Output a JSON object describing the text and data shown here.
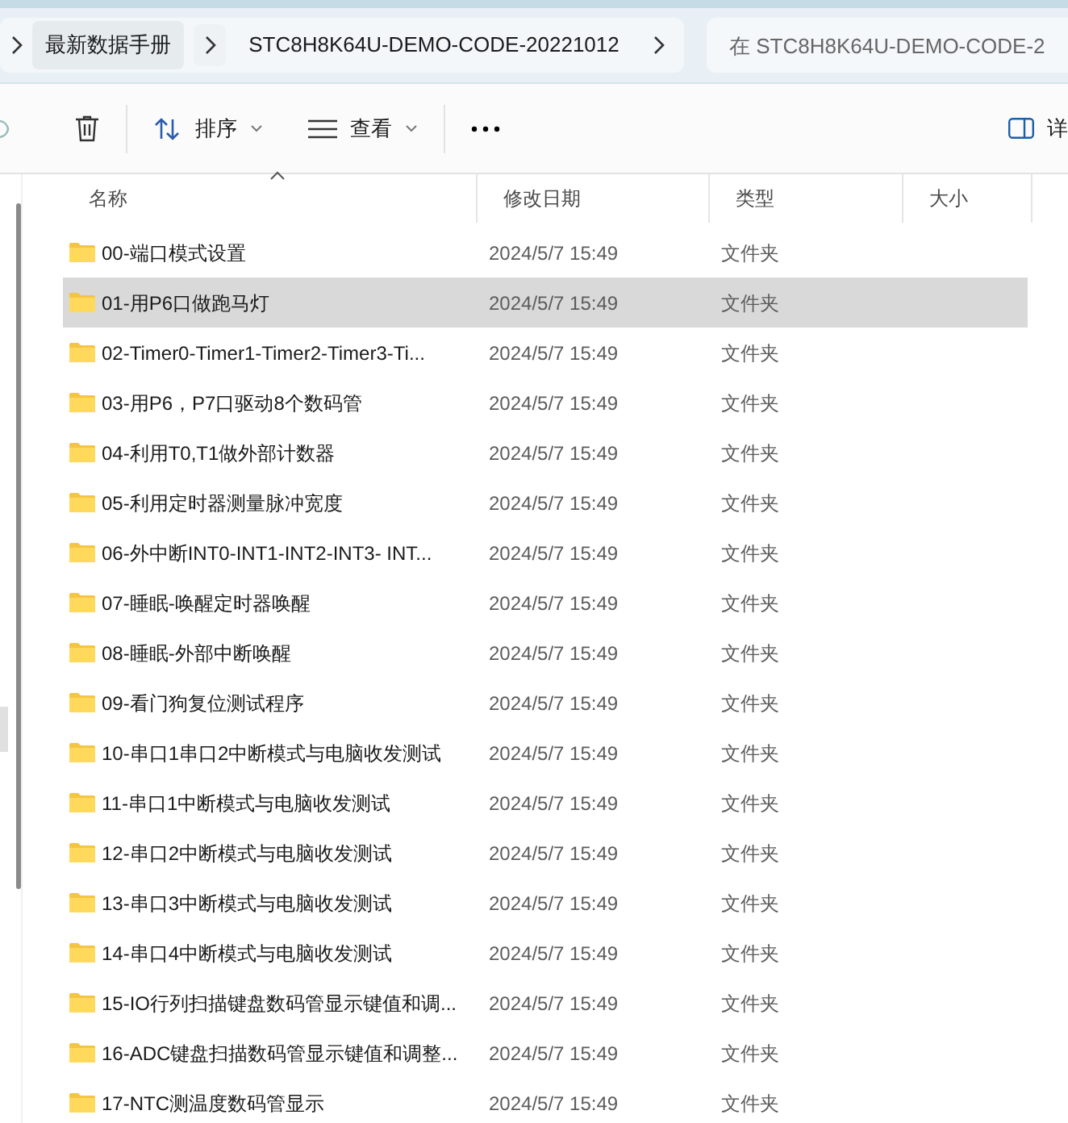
{
  "address_bar": {
    "breadcrumbs": [
      {
        "label": "最新数据手册"
      },
      {
        "label": "STC8H8K64U-DEMO-CODE-20221012"
      }
    ],
    "search": {
      "placeholder": "在 STC8H8K64U-DEMO-CODE-2"
    }
  },
  "toolbar": {
    "sort": {
      "label": "排序"
    },
    "view": {
      "label": "查看"
    },
    "details": {
      "label": "详"
    }
  },
  "table": {
    "columns": [
      {
        "label": "名称",
        "sorted": true
      },
      {
        "label": "修改日期",
        "sorted": false
      },
      {
        "label": "类型",
        "sorted": false
      },
      {
        "label": "大小",
        "sorted": false
      }
    ],
    "rows": [
      {
        "name": "00-端口模式设置",
        "modified": "2024/5/7 15:49",
        "type": "文件夹",
        "selected": false
      },
      {
        "name": "01-用P6口做跑马灯",
        "modified": "2024/5/7 15:49",
        "type": "文件夹",
        "selected": true
      },
      {
        "name": "02-Timer0-Timer1-Timer2-Timer3-Ti...",
        "modified": "2024/5/7 15:49",
        "type": "文件夹",
        "selected": false
      },
      {
        "name": "03-用P6，P7口驱动8个数码管",
        "modified": "2024/5/7 15:49",
        "type": "文件夹",
        "selected": false
      },
      {
        "name": "04-利用T0,T1做外部计数器",
        "modified": "2024/5/7 15:49",
        "type": "文件夹",
        "selected": false
      },
      {
        "name": "05-利用定时器测量脉冲宽度",
        "modified": "2024/5/7 15:49",
        "type": "文件夹",
        "selected": false
      },
      {
        "name": "06-外中断INT0-INT1-INT2-INT3- INT...",
        "modified": "2024/5/7 15:49",
        "type": "文件夹",
        "selected": false
      },
      {
        "name": "07-睡眠-唤醒定时器唤醒",
        "modified": "2024/5/7 15:49",
        "type": "文件夹",
        "selected": false
      },
      {
        "name": "08-睡眠-外部中断唤醒",
        "modified": "2024/5/7 15:49",
        "type": "文件夹",
        "selected": false
      },
      {
        "name": "09-看门狗复位测试程序",
        "modified": "2024/5/7 15:49",
        "type": "文件夹",
        "selected": false
      },
      {
        "name": "10-串口1串口2中断模式与电脑收发测试",
        "modified": "2024/5/7 15:49",
        "type": "文件夹",
        "selected": false
      },
      {
        "name": "11-串口1中断模式与电脑收发测试",
        "modified": "2024/5/7 15:49",
        "type": "文件夹",
        "selected": false
      },
      {
        "name": "12-串口2中断模式与电脑收发测试",
        "modified": "2024/5/7 15:49",
        "type": "文件夹",
        "selected": false
      },
      {
        "name": "13-串口3中断模式与电脑收发测试",
        "modified": "2024/5/7 15:49",
        "type": "文件夹",
        "selected": false
      },
      {
        "name": "14-串口4中断模式与电脑收发测试",
        "modified": "2024/5/7 15:49",
        "type": "文件夹",
        "selected": false
      },
      {
        "name": "15-IO行列扫描键盘数码管显示键值和调...",
        "modified": "2024/5/7 15:49",
        "type": "文件夹",
        "selected": false
      },
      {
        "name": "16-ADC键盘扫描数码管显示键值和调整...",
        "modified": "2024/5/7 15:49",
        "type": "文件夹",
        "selected": false
      },
      {
        "name": "17-NTC测温度数码管显示",
        "modified": "2024/5/7 15:49",
        "type": "文件夹",
        "selected": false
      }
    ]
  }
}
